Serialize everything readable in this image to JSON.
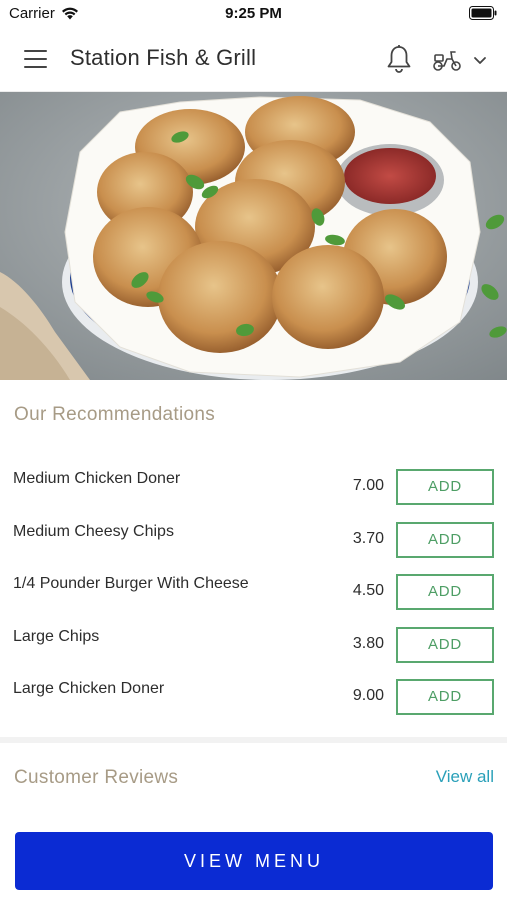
{
  "status_bar": {
    "carrier": "Carrier",
    "time": "9:25 PM"
  },
  "header": {
    "title": "Station Fish & Grill",
    "icons": [
      "menu-icon",
      "bell-icon",
      "scooter-icon",
      "chevron-down-icon"
    ]
  },
  "recommendations": {
    "title": "Our Recommendations",
    "items": [
      {
        "name": "Medium Chicken Doner",
        "price": "7.00",
        "add_label": "ADD"
      },
      {
        "name": "Medium Cheesy Chips",
        "price": "3.70",
        "add_label": "ADD"
      },
      {
        "name": "1/4 Pounder Burger With Cheese",
        "price": "4.50",
        "add_label": "ADD"
      },
      {
        "name": "Large Chips",
        "price": "3.80",
        "add_label": "ADD"
      },
      {
        "name": "Large Chicken Doner",
        "price": "9.00",
        "add_label": "ADD"
      }
    ]
  },
  "reviews": {
    "title": "Customer Reviews",
    "view_all": "View all"
  },
  "view_menu_label": "VIEW MENU",
  "colors": {
    "accent_blue": "#0b2bd3",
    "add_green": "#59a86f",
    "section_title": "#a79b86",
    "link": "#2aa0b9"
  }
}
